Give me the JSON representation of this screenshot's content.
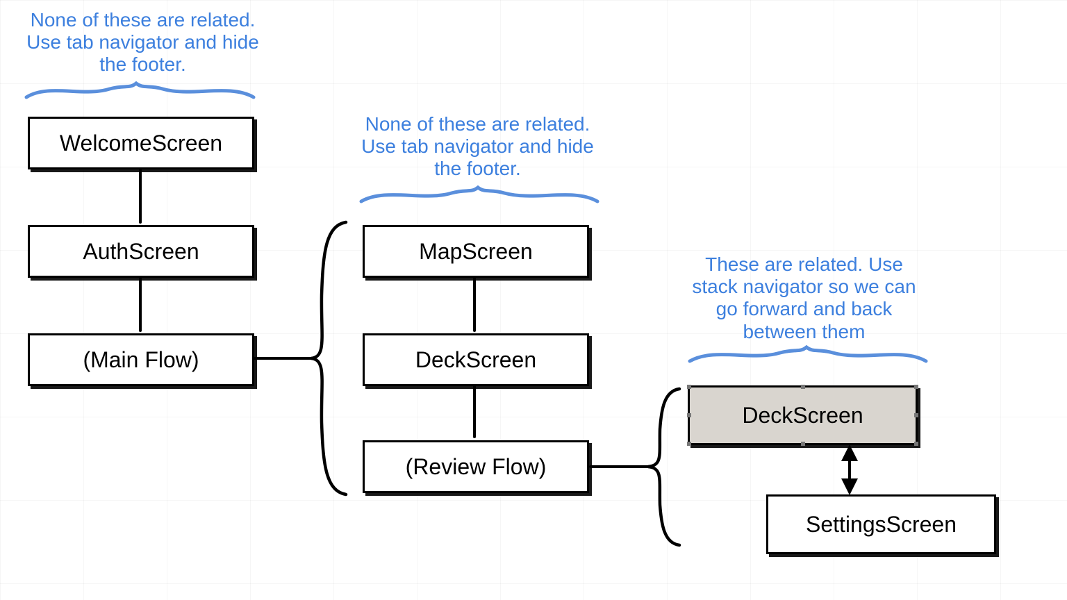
{
  "annotations": {
    "group1": "None of these are related.\nUse tab navigator and hide\nthe footer.",
    "group2": "None of these are related.\nUse tab navigator and hide\nthe footer.",
    "group3": "These are related.  Use\nstack navigator so we can\ngo forward and back\nbetween them"
  },
  "boxes": {
    "welcome": "WelcomeScreen",
    "auth": "AuthScreen",
    "mainflow": "(Main Flow)",
    "map": "MapScreen",
    "deck": "DeckScreen",
    "reviewflow": "(Review Flow)",
    "deck2": "DeckScreen",
    "settings": "SettingsScreen"
  }
}
